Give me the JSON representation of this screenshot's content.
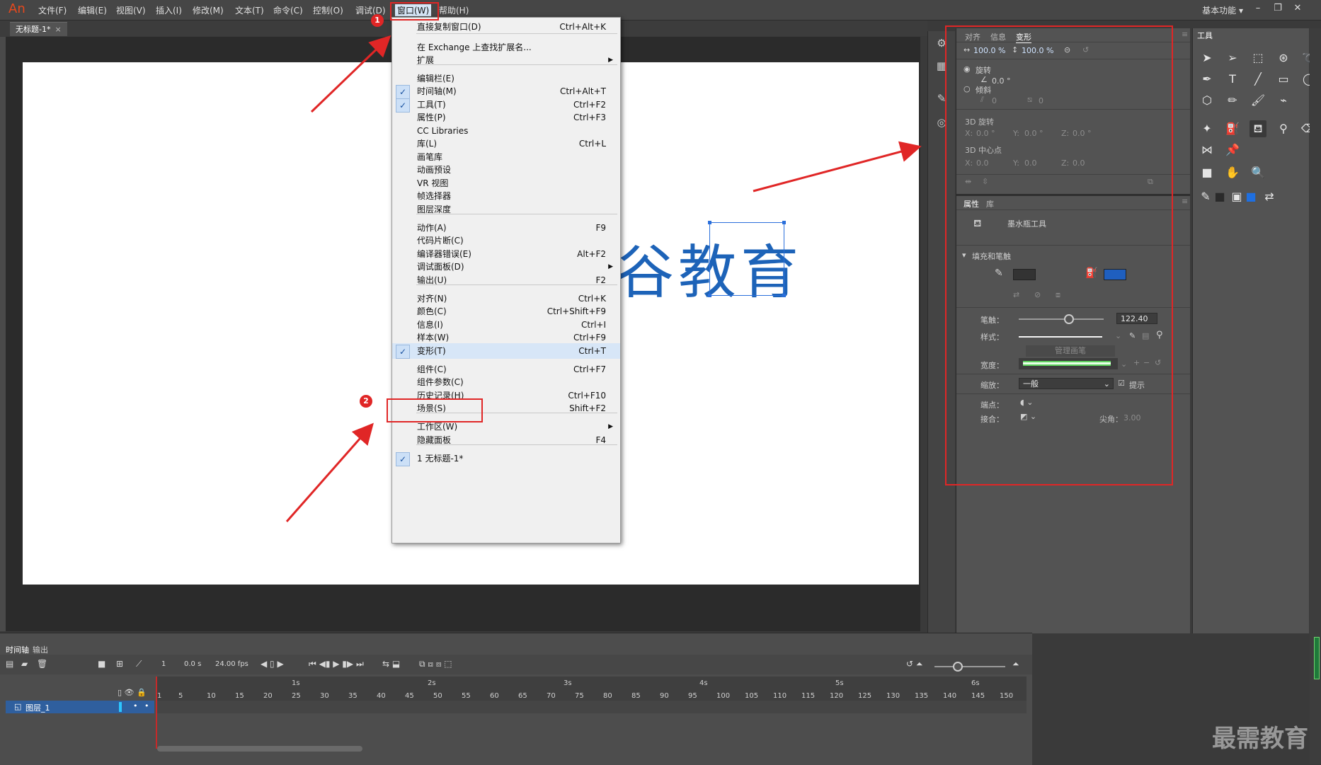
{
  "app": {
    "logo": "An",
    "menus": [
      "文件(F)",
      "编辑(E)",
      "视图(V)",
      "插入(I)",
      "修改(M)",
      "文本(T)",
      "命令(C)",
      "控制(O)",
      "调试(D)",
      "窗口(W)",
      "帮助(H)"
    ],
    "workspace": "基本功能",
    "doc_tab": "无标题-1*"
  },
  "stage": {
    "text": "谷教育"
  },
  "window_menu": {
    "items": [
      {
        "label": "直接复制窗口(D)",
        "shortcut": "Ctrl+Alt+K"
      },
      {
        "label": "在 Exchange 上查找扩展名...",
        "shortcut": ""
      },
      {
        "label": "扩展",
        "shortcut": ""
      },
      {
        "label": "编辑栏(E)",
        "shortcut": ""
      },
      {
        "label": "时间轴(M)",
        "shortcut": "Ctrl+Alt+T"
      },
      {
        "label": "工具(T)",
        "shortcut": "Ctrl+F2"
      },
      {
        "label": "属性(P)",
        "shortcut": "Ctrl+F3"
      },
      {
        "label": "CC Libraries",
        "shortcut": ""
      },
      {
        "label": "库(L)",
        "shortcut": "Ctrl+L"
      },
      {
        "label": "画笔库",
        "shortcut": ""
      },
      {
        "label": "动画预设",
        "shortcut": ""
      },
      {
        "label": "VR 视图",
        "shortcut": ""
      },
      {
        "label": "帧选择器",
        "shortcut": ""
      },
      {
        "label": "图层深度",
        "shortcut": ""
      },
      {
        "label": "动作(A)",
        "shortcut": "F9"
      },
      {
        "label": "代码片断(C)",
        "shortcut": ""
      },
      {
        "label": "编译器错误(E)",
        "shortcut": "Alt+F2"
      },
      {
        "label": "调试面板(D)",
        "shortcut": ""
      },
      {
        "label": "输出(U)",
        "shortcut": "F2"
      },
      {
        "label": "对齐(N)",
        "shortcut": "Ctrl+K"
      },
      {
        "label": "颜色(C)",
        "shortcut": "Ctrl+Shift+F9"
      },
      {
        "label": "信息(I)",
        "shortcut": "Ctrl+I"
      },
      {
        "label": "样本(W)",
        "shortcut": "Ctrl+F9"
      },
      {
        "label": "变形(T)",
        "shortcut": "Ctrl+T"
      },
      {
        "label": "组件(C)",
        "shortcut": "Ctrl+F7"
      },
      {
        "label": "组件参数(C)",
        "shortcut": ""
      },
      {
        "label": "历史记录(H)",
        "shortcut": "Ctrl+F10"
      },
      {
        "label": "场景(S)",
        "shortcut": "Shift+F2"
      },
      {
        "label": "工作区(W)",
        "shortcut": ""
      },
      {
        "label": "隐藏面板",
        "shortcut": "F4"
      },
      {
        "label": "1 无标题-1*",
        "shortcut": ""
      }
    ]
  },
  "annotations": {
    "badge1": "1",
    "badge2": "2"
  },
  "transform_panel": {
    "tabs": [
      "对齐",
      "信息",
      "变形"
    ],
    "scale_w": "100.0 %",
    "scale_h": "100.0 %",
    "rotate_label": "旋转",
    "rotate_value": "0.0 °",
    "skew_label": "倾斜",
    "skew_h": "0",
    "skew_v": "0",
    "rot3d_label": "3D 旋转",
    "center3d_label": "3D 中心点",
    "x_label": "X:",
    "y_label": "Y:",
    "z_label": "Z:",
    "zero": "0.0",
    "deg_zero": "0.0 °"
  },
  "properties_panel": {
    "tabs": [
      "属性",
      "库"
    ],
    "tool_name": "墨水瓶工具",
    "section": "填充和笔触",
    "stroke_color": "#333333",
    "fill_color": "#1f5fbf",
    "stroke_label": "笔触：",
    "stroke_value": "122.40",
    "style_label": "样式：",
    "manage_brush": "管理画笔",
    "width_label": "宽度：",
    "scale_label": "缩放：",
    "scale_value": "一般",
    "hint_label": "提示",
    "cap_label": "端点：",
    "join_label": "接合：",
    "miter_label": "尖角：",
    "miter_value": "3.00"
  },
  "tools_panel": {
    "title": "工具"
  },
  "timeline": {
    "tabs": [
      "时间轴",
      "输出"
    ],
    "frame": "1",
    "time": "0.0 s",
    "fps": "24.00 fps",
    "seconds": [
      "1s",
      "2s",
      "3s",
      "4s",
      "5s",
      "6s"
    ],
    "frame_ticks": [
      "1",
      "5",
      "10",
      "15",
      "20",
      "25",
      "30",
      "35",
      "40",
      "45",
      "50",
      "55",
      "60",
      "65",
      "70",
      "75",
      "80",
      "85",
      "90",
      "95",
      "100",
      "105",
      "110",
      "115",
      "120",
      "125",
      "130",
      "135",
      "140",
      "145",
      "150"
    ],
    "layer_name": "图层_1"
  },
  "watermark": "最需教育"
}
